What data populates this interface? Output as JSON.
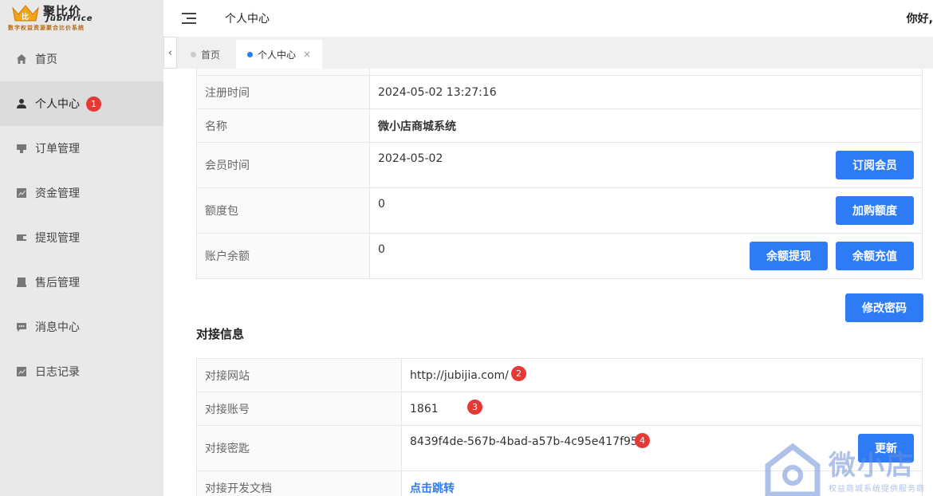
{
  "brand": {
    "title": "聚比价",
    "subtitle": "JubiPrice",
    "tagline": "数字权益资源聚合比价系统"
  },
  "sidebar": {
    "items": [
      {
        "label": "首页",
        "icon": "home-icon",
        "active": false
      },
      {
        "label": "个人中心",
        "icon": "user-icon",
        "active": true,
        "badge": "1"
      },
      {
        "label": "订单管理",
        "icon": "order-icon",
        "active": false
      },
      {
        "label": "资金管理",
        "icon": "chart-icon",
        "active": false
      },
      {
        "label": "提现管理",
        "icon": "withdraw-icon",
        "active": false
      },
      {
        "label": "售后管理",
        "icon": "aftersale-icon",
        "active": false
      },
      {
        "label": "消息中心",
        "icon": "message-icon",
        "active": false
      },
      {
        "label": "日志记录",
        "icon": "log-icon",
        "active": false
      }
    ]
  },
  "header": {
    "title": "个人中心",
    "greeting": "你好,"
  },
  "tabs": [
    {
      "label": "首页",
      "active": false
    },
    {
      "label": "个人中心",
      "active": true,
      "close": "×"
    }
  ],
  "account": {
    "rows": [
      {
        "label": "注册时间",
        "value": "2024-05-02 13:27:16"
      },
      {
        "label": "名称",
        "value": "微小店商城系统"
      },
      {
        "label": "会员时间",
        "value": "2024-05-02",
        "button": "订阅会员"
      },
      {
        "label": "额度包",
        "value": "0",
        "button": "加购额度"
      },
      {
        "label": "账户余额",
        "value": "0",
        "button": "余额充值",
        "button2": "余额提现"
      }
    ],
    "change_password": "修改密码"
  },
  "integration": {
    "title": "对接信息",
    "rows": [
      {
        "label": "对接网站",
        "value": "http://jubijia.com/",
        "badge": "2"
      },
      {
        "label": "对接账号",
        "value": "1861",
        "badge": "3"
      },
      {
        "label": "对接密匙",
        "value": "8439f4de-567b-4bad-a57b-4c95e417f954",
        "badge": "4",
        "button": "更新"
      },
      {
        "label": "对接开发文档",
        "value": "点击跳转"
      }
    ]
  },
  "watermark": {
    "text": "微小店",
    "sub": "权益商城系统提供服务商"
  },
  "colors": {
    "primary": "#2d7cf6",
    "badge": "#e53935",
    "sidebar_bg": "#e9e9e9"
  }
}
